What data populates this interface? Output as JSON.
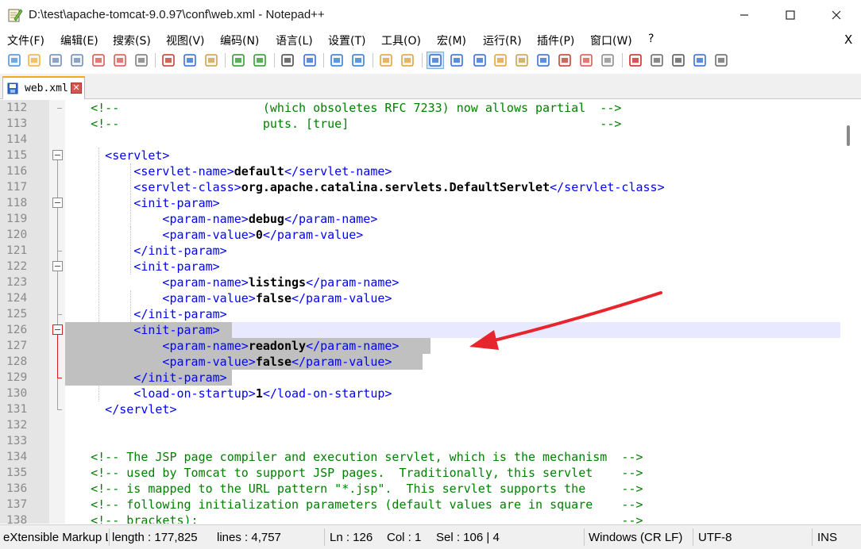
{
  "window": {
    "title": "D:\\test\\apache-tomcat-9.0.97\\conf\\web.xml - Notepad++",
    "minimize_glyph": "—",
    "maximize_glyph": "☐",
    "close_glyph": "✕"
  },
  "menu": {
    "items": [
      "文件(F)",
      "编辑(E)",
      "搜索(S)",
      "视图(V)",
      "编码(N)",
      "语言(L)",
      "设置(T)",
      "工具(O)",
      "宏(M)",
      "运行(R)",
      "插件(P)",
      "窗口(W)",
      "?"
    ],
    "close_glyph": "X"
  },
  "toolbar": {
    "icons": [
      "new-file-icon",
      "open-file-icon",
      "save-icon",
      "save-all-icon",
      "close-icon",
      "close-all-icon",
      "print-icon",
      "cut-icon",
      "copy-icon",
      "paste-icon",
      "undo-icon",
      "redo-icon",
      "find-icon",
      "replace-icon",
      "zoom-in-icon",
      "zoom-out-icon",
      "sync-vertical-icon",
      "sync-horizontal-icon",
      "word-wrap-icon",
      "show-all-chars-icon",
      "indent-guide-icon",
      "user-lang-icon",
      "doc-map-icon",
      "doc-list-icon",
      "function-list-icon",
      "folder-workspace-icon",
      "monitoring-icon",
      "record-macro-icon",
      "stop-record-icon",
      "play-macro-icon",
      "run-macro-multiple-icon",
      "save-macro-icon"
    ]
  },
  "tab": {
    "label": "web.xml",
    "close_glyph": "✕"
  },
  "editor": {
    "lines": [
      {
        "num": "112",
        "parts": [
          {
            "t": "c",
            "s": "    <!--                    (which obsoletes RFC 7233) now allows partial  -->"
          }
        ]
      },
      {
        "num": "113",
        "parts": [
          {
            "t": "c",
            "s": "    <!--                    puts. [true]                                   -->"
          }
        ]
      },
      {
        "num": "114",
        "parts": []
      },
      {
        "num": "115",
        "parts": [
          {
            "t": "g",
            "s": "      <servlet>"
          }
        ]
      },
      {
        "num": "116",
        "parts": [
          {
            "t": "g",
            "s": "          <servlet-name>"
          },
          {
            "t": "x",
            "s": "default"
          },
          {
            "t": "g",
            "s": "</servlet-name>"
          }
        ]
      },
      {
        "num": "117",
        "parts": [
          {
            "t": "g",
            "s": "          <servlet-class>"
          },
          {
            "t": "x",
            "s": "org.apache.catalina.servlets.DefaultServlet"
          },
          {
            "t": "g",
            "s": "</servlet-class>"
          }
        ]
      },
      {
        "num": "118",
        "parts": [
          {
            "t": "g",
            "s": "          <init-param>"
          }
        ]
      },
      {
        "num": "119",
        "parts": [
          {
            "t": "g",
            "s": "              <param-name>"
          },
          {
            "t": "x",
            "s": "debug"
          },
          {
            "t": "g",
            "s": "</param-name>"
          }
        ]
      },
      {
        "num": "120",
        "parts": [
          {
            "t": "g",
            "s": "              <param-value>"
          },
          {
            "t": "x",
            "s": "0"
          },
          {
            "t": "g",
            "s": "</param-value>"
          }
        ]
      },
      {
        "num": "121",
        "parts": [
          {
            "t": "g",
            "s": "          </init-param>"
          }
        ]
      },
      {
        "num": "122",
        "parts": [
          {
            "t": "g",
            "s": "          <init-param>"
          }
        ]
      },
      {
        "num": "123",
        "parts": [
          {
            "t": "g",
            "s": "              <param-name>"
          },
          {
            "t": "x",
            "s": "listings"
          },
          {
            "t": "g",
            "s": "</param-name>"
          }
        ]
      },
      {
        "num": "124",
        "parts": [
          {
            "t": "g",
            "s": "              <param-value>"
          },
          {
            "t": "x",
            "s": "false"
          },
          {
            "t": "g",
            "s": "</param-value>"
          }
        ]
      },
      {
        "num": "125",
        "parts": [
          {
            "t": "g",
            "s": "          </init-param>"
          }
        ]
      },
      {
        "num": "126",
        "parts": [
          {
            "t": "g",
            "s": "          <init-param>"
          }
        ]
      },
      {
        "num": "127",
        "parts": [
          {
            "t": "g",
            "s": "              <param-name>"
          },
          {
            "t": "x",
            "s": "readonly"
          },
          {
            "t": "g",
            "s": "</param-name>"
          }
        ]
      },
      {
        "num": "128",
        "parts": [
          {
            "t": "g",
            "s": "              <param-value>"
          },
          {
            "t": "x",
            "s": "false"
          },
          {
            "t": "g",
            "s": "</param-value>"
          }
        ]
      },
      {
        "num": "129",
        "parts": [
          {
            "t": "g",
            "s": "          </init-param>"
          }
        ]
      },
      {
        "num": "130",
        "parts": [
          {
            "t": "g",
            "s": "          <load-on-startup>"
          },
          {
            "t": "x",
            "s": "1"
          },
          {
            "t": "g",
            "s": "</load-on-startup>"
          }
        ]
      },
      {
        "num": "131",
        "parts": [
          {
            "t": "g",
            "s": "      </servlet>"
          }
        ]
      },
      {
        "num": "132",
        "parts": []
      },
      {
        "num": "133",
        "parts": []
      },
      {
        "num": "134",
        "parts": [
          {
            "t": "c",
            "s": "    <!-- The JSP page compiler and execution servlet, which is the mechanism  -->"
          }
        ]
      },
      {
        "num": "135",
        "parts": [
          {
            "t": "c",
            "s": "    <!-- used by Tomcat to support JSP pages.  Traditionally, this servlet    -->"
          }
        ]
      },
      {
        "num": "136",
        "parts": [
          {
            "t": "c",
            "s": "    <!-- is mapped to the URL pattern \"*.jsp\".  This servlet supports the     -->"
          }
        ]
      },
      {
        "num": "137",
        "parts": [
          {
            "t": "c",
            "s": "    <!-- following initialization parameters (default values are in square    -->"
          }
        ]
      },
      {
        "num": "138",
        "parts": [
          {
            "t": "c",
            "s": "    <!-- brackets):                                                           -->"
          }
        ]
      }
    ]
  },
  "status": {
    "doc_type": "eXtensible Markup Language file",
    "length": "length : 177,825",
    "lines": "lines : 4,757",
    "ln": "Ln : 126",
    "col": "Col : 1",
    "sel": "Sel : 106 | 4",
    "eol": "Windows (CR LF)",
    "encoding": "UTF-8",
    "ins": "INS"
  },
  "colors": {
    "comment": "#008000",
    "tag": "#0000ff",
    "text": "#000000",
    "selection": "#c0c0c0",
    "current_line": "#e8e8ff",
    "annotation_arrow": "#e8252d"
  }
}
